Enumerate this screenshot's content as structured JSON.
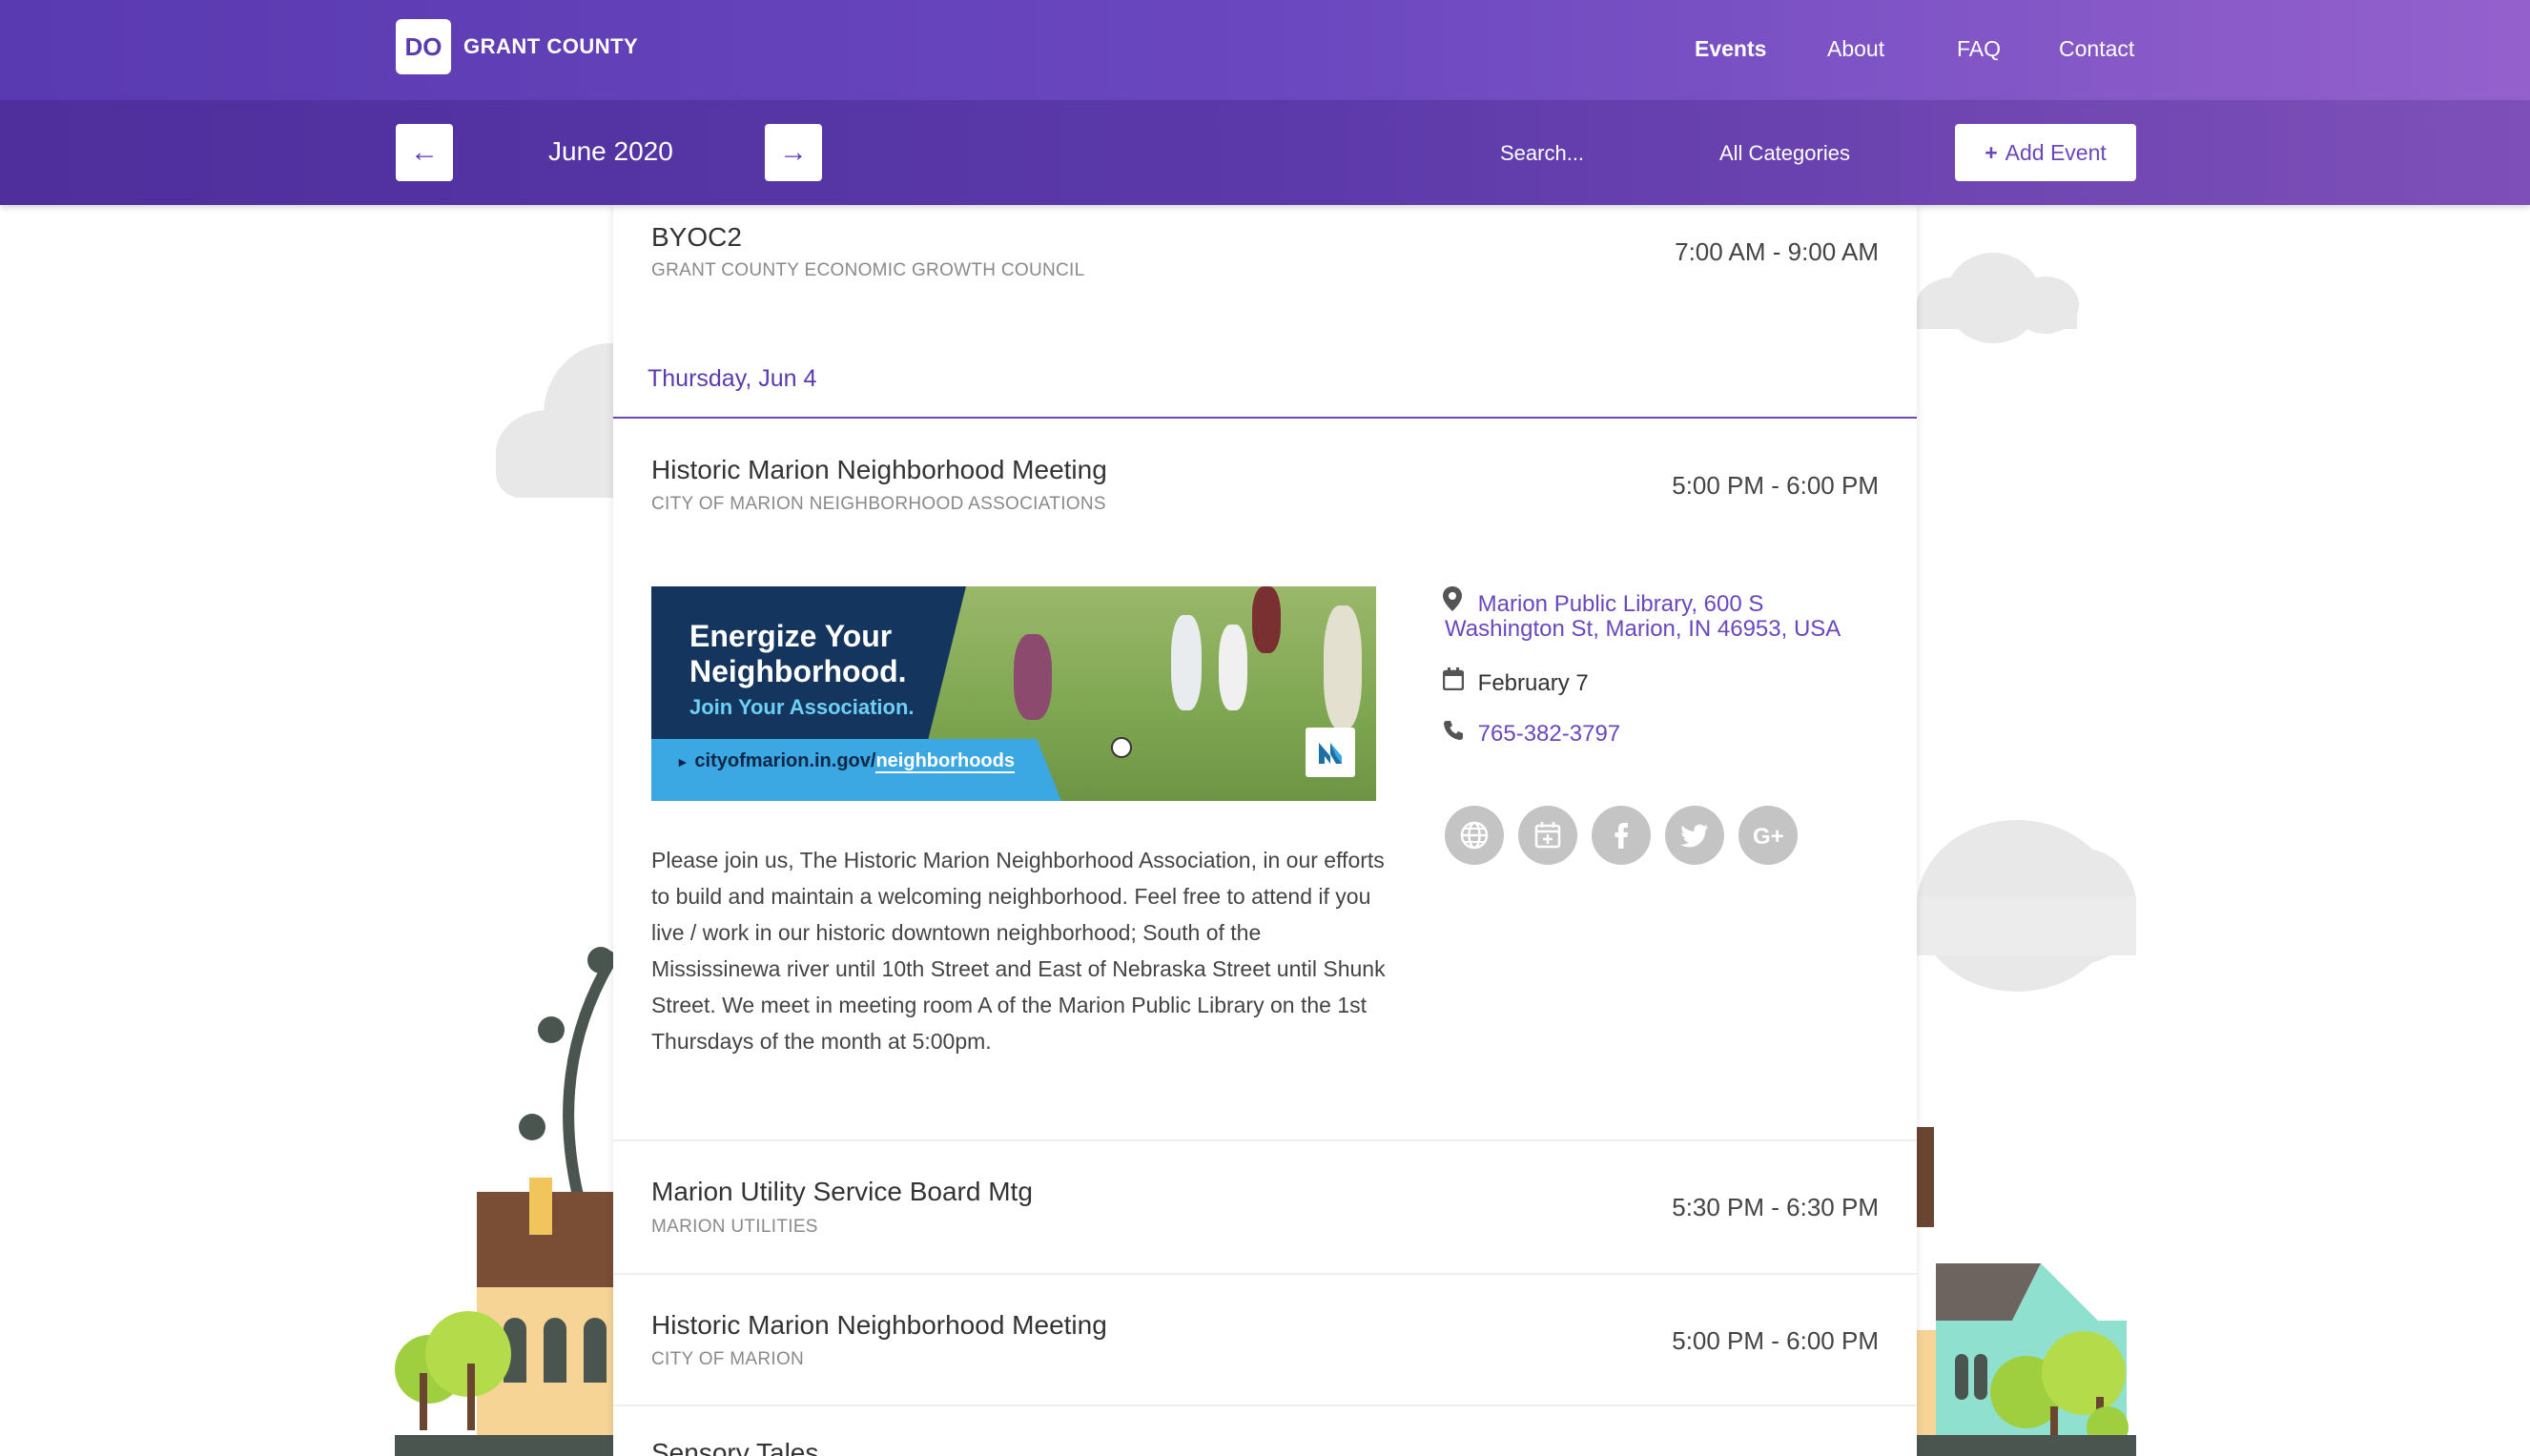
{
  "header": {
    "logo_text": "DO",
    "brand": "GRANT COUNTY",
    "nav": [
      "Events",
      "About",
      "FAQ",
      "Contact"
    ]
  },
  "toolbar": {
    "prev_icon": "arrow-left-icon",
    "next_icon": "arrow-right-icon",
    "month": "June 2020",
    "search_placeholder": "Search...",
    "category": "All Categories",
    "add_label": "Add Event"
  },
  "events": {
    "first": {
      "title": "BYOC2",
      "org": "GRANT COUNTY ECONOMIC GROWTH COUNCIL",
      "time": "7:00 AM - 9:00 AM"
    },
    "day_heading": "Thursday, Jun 4",
    "expanded": {
      "title": "Historic Marion Neighborhood Meeting",
      "org": "CITY OF MARION NEIGHBORHOOD ASSOCIATIONS",
      "time": "5:00 PM - 6:00 PM",
      "banner": {
        "line1": "Energize Your",
        "line2": "Neighborhood.",
        "line3": "Join Your Association.",
        "url_prefix": "cityofmarion.in.gov/",
        "url_highlight": "neighborhoods"
      },
      "description": "Please join us, The Historic Marion Neighborhood Association, in our efforts to build and maintain a welcoming neighborhood. Feel free to attend if you live / work in our historic downtown neighborhood; South of the Mississinewa river until 10th Street and East of Nebraska Street until Shunk Street. We meet in meeting room A of the Marion Public Library on the 1st Thursdays of the month at 5:00pm.",
      "location_line1": "Marion Public Library, 600 S",
      "location_line2": "Washington St, Marion, IN 46953, USA",
      "date": "February 7",
      "phone": "765-382-3797",
      "social_icons": [
        "globe-icon",
        "calendar-add-icon",
        "facebook-icon",
        "twitter-icon",
        "google-plus-icon"
      ]
    },
    "list": [
      {
        "title": "Marion Utility Service Board Mtg",
        "org": "MARION UTILITIES",
        "time": "5:30 PM - 6:30 PM"
      },
      {
        "title": "Historic Marion Neighborhood Meeting",
        "org": "CITY OF MARION",
        "time": "5:00 PM - 6:00 PM"
      },
      {
        "title": "Sensory Tales"
      }
    ]
  },
  "colors": {
    "brand_purple": "#5a3ab0",
    "accent": "#6a47bf",
    "banner_navy": "#14365e",
    "banner_blue": "#3ba8e4"
  }
}
